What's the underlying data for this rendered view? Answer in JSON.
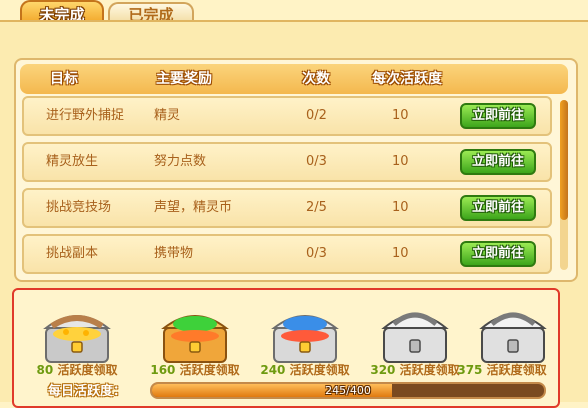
{
  "tabs": [
    {
      "label": "未完成",
      "active": true
    },
    {
      "label": "已完成",
      "active": false
    }
  ],
  "table": {
    "headers": [
      "目标",
      "主要奖励",
      "次数",
      "每次活跃度"
    ],
    "rows": [
      {
        "goal": "进行野外捕捉",
        "reward": "精灵",
        "count": "0/2",
        "points": "10",
        "button": "立即前往"
      },
      {
        "goal": "精灵放生",
        "reward": "努力点数",
        "count": "0/3",
        "points": "10",
        "button": "立即前往"
      },
      {
        "goal": "挑战竞技场",
        "reward": "声望，精灵币",
        "count": "2/5",
        "points": "10",
        "button": "立即前往"
      },
      {
        "goal": "挑战副本",
        "reward": "携带物",
        "count": "0/3",
        "points": "10",
        "button": "立即前往"
      }
    ]
  },
  "rewards": [
    {
      "value": "80",
      "text": "活跃度领取",
      "variant": "gold"
    },
    {
      "value": "160",
      "text": "活跃度领取",
      "variant": "green"
    },
    {
      "value": "240",
      "text": "活跃度领取",
      "variant": "blue"
    },
    {
      "value": "320",
      "text": "活跃度领取",
      "variant": "silver"
    },
    {
      "value": "375",
      "text": "活跃度领取",
      "variant": "silver"
    }
  ],
  "daily": {
    "label": "每日活跃度：",
    "progress_text": "245/400",
    "progress_value": 245,
    "progress_max": 400
  },
  "colors": {
    "accent": "#f0a020",
    "button_green": "#3da51b",
    "highlight_border": "#e03a2a"
  }
}
